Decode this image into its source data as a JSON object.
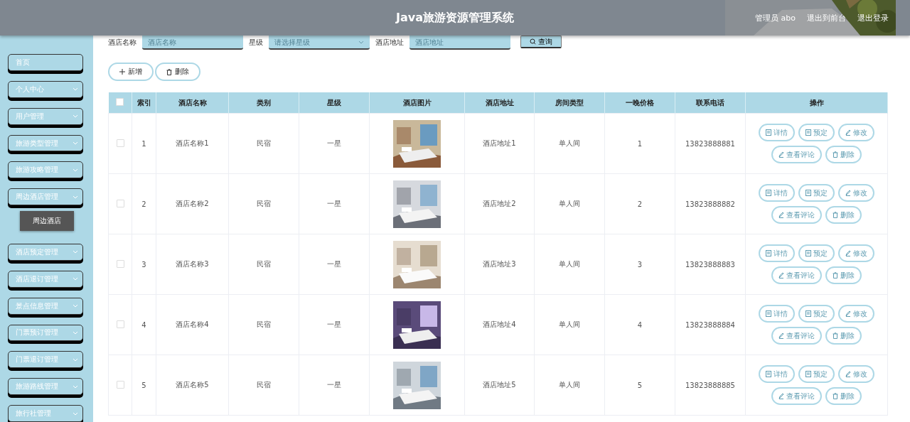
{
  "header": {
    "title": "Java旅游资源管理系统",
    "links": [
      "管理员 abo",
      "退出到前台",
      "退出登录"
    ]
  },
  "sidebar": {
    "items": [
      {
        "label": "首页",
        "kind": "link"
      },
      {
        "label": "个人中心",
        "kind": "menu"
      },
      {
        "label": "用户管理",
        "kind": "menu"
      },
      {
        "label": "旅游类型管理",
        "kind": "menu"
      },
      {
        "label": "旅游攻略管理",
        "kind": "menu"
      },
      {
        "label": "周边酒店管理",
        "kind": "menu",
        "children": [
          {
            "label": "周边酒店"
          }
        ]
      },
      {
        "label": "酒店预定管理",
        "kind": "menu"
      },
      {
        "label": "酒店退订管理",
        "kind": "menu"
      },
      {
        "label": "景点信息管理",
        "kind": "menu"
      },
      {
        "label": "门票预订管理",
        "kind": "menu"
      },
      {
        "label": "门票退订管理",
        "kind": "menu"
      },
      {
        "label": "旅游路线管理",
        "kind": "menu"
      },
      {
        "label": "旅行社管理",
        "kind": "menu"
      }
    ]
  },
  "search": {
    "fields": [
      {
        "label": "酒店名称",
        "placeholder": "酒店名称",
        "kind": "input"
      },
      {
        "label": "星级",
        "placeholder": "请选择星级",
        "kind": "select"
      },
      {
        "label": "酒店地址",
        "placeholder": "酒店地址",
        "kind": "input"
      }
    ],
    "button": "查询"
  },
  "actions": [
    "新增",
    "删除"
  ],
  "table": {
    "all_checked": false,
    "columns": [
      "索引",
      "酒店名称",
      "类别",
      "星级",
      "酒店图片",
      "酒店地址",
      "房间类型",
      "一晚价格",
      "联系电话",
      "操作"
    ],
    "rows": [
      {
        "checked": false,
        "cells": [
          "1",
          "酒店名称1",
          "民宿",
          "一星",
          "",
          "酒店地址1",
          "单人间",
          "1",
          "13823888881"
        ],
        "buttons": [
          "详情",
          "预定",
          "修改",
          "查看评论",
          "删除"
        ]
      },
      {
        "checked": false,
        "cells": [
          "2",
          "酒店名称2",
          "民宿",
          "一星",
          "",
          "酒店地址2",
          "单人间",
          "2",
          "13823888882"
        ],
        "buttons": [
          "详情",
          "预定",
          "修改",
          "查看评论",
          "删除"
        ]
      },
      {
        "checked": false,
        "cells": [
          "3",
          "酒店名称3",
          "民宿",
          "一星",
          "",
          "酒店地址3",
          "单人间",
          "3",
          "13823888883"
        ],
        "buttons": [
          "详情",
          "预定",
          "修改",
          "查看评论",
          "删除"
        ]
      },
      {
        "checked": false,
        "cells": [
          "4",
          "酒店名称4",
          "民宿",
          "一星",
          "",
          "酒店地址4",
          "单人间",
          "4",
          "13823888884"
        ],
        "buttons": [
          "详情",
          "预定",
          "修改",
          "查看评论",
          "删除"
        ]
      },
      {
        "checked": false,
        "cells": [
          "5",
          "酒店名称5",
          "民宿",
          "一星",
          "",
          "酒店地址5",
          "单人间",
          "5",
          "13823888885"
        ],
        "buttons": [
          "详情",
          "预定",
          "修改",
          "查看评论",
          "删除"
        ]
      }
    ]
  }
}
